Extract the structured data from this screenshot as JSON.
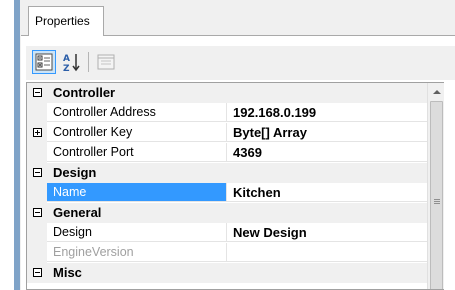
{
  "panel": {
    "tab_label": "Properties",
    "toolbar": {
      "categorized_icon": "categorized-view-icon",
      "alphabetical_icon": "alphabetical-sort-icon",
      "property_pages_icon": "property-pages-icon"
    }
  },
  "grid": {
    "categories": [
      {
        "name": "Controller",
        "properties": [
          {
            "name": "Controller Address",
            "value": "192.168.0.199"
          },
          {
            "name": "Controller Key",
            "value": "Byte[] Array"
          },
          {
            "name": "Controller Port",
            "value": "4369"
          }
        ]
      },
      {
        "name": "Design",
        "properties": [
          {
            "name": "Name",
            "value": "Kitchen"
          }
        ]
      },
      {
        "name": "General",
        "properties": [
          {
            "name": "Design",
            "value": "New Design"
          },
          {
            "name": "EngineVersion",
            "value": ""
          }
        ]
      },
      {
        "name": "Misc",
        "properties": []
      }
    ]
  },
  "colors": {
    "selection": "#3399ff",
    "category_bg": "#f0f0f0",
    "disabled_text": "#a0a0a0"
  }
}
